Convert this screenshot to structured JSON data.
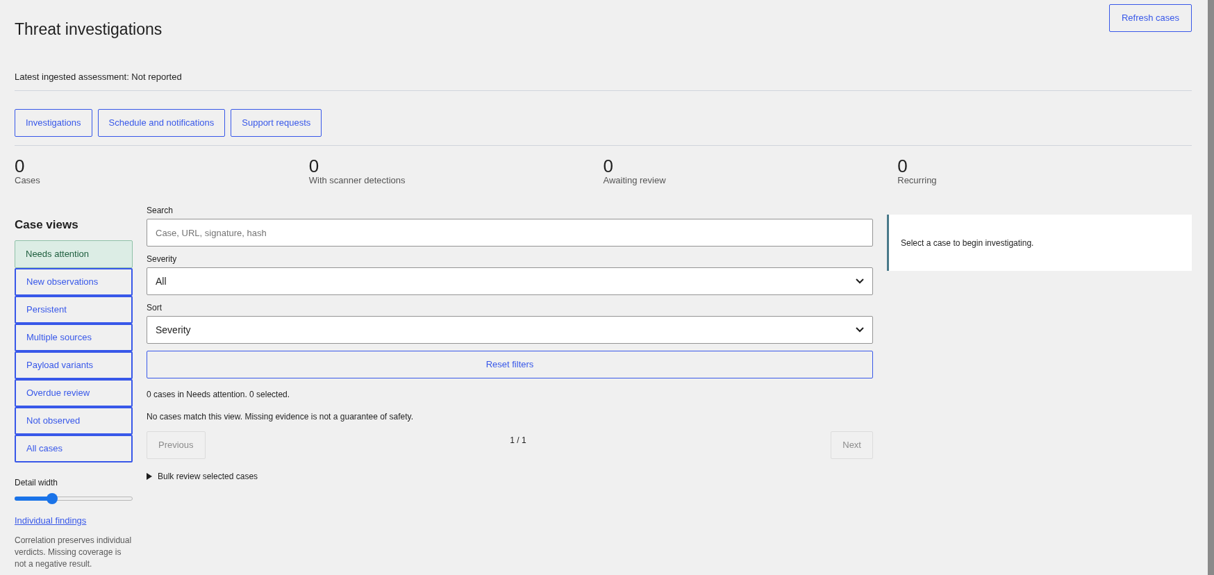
{
  "header": {
    "title": "Threat investigations",
    "refresh_button": "Refresh cases",
    "assessment": "Latest ingested assessment: Not reported"
  },
  "nav_buttons": [
    "Investigations",
    "Schedule and notifications",
    "Support requests"
  ],
  "stats": [
    {
      "value": "0",
      "label": "Cases"
    },
    {
      "value": "0",
      "label": "With scanner detections"
    },
    {
      "value": "0",
      "label": "Awaiting review"
    },
    {
      "value": "0",
      "label": "Recurring"
    }
  ],
  "sidebar": {
    "title": "Case views",
    "items": [
      {
        "label": "Needs attention",
        "selected": true
      },
      {
        "label": "New observations",
        "selected": false
      },
      {
        "label": "Persistent",
        "selected": false
      },
      {
        "label": "Multiple sources",
        "selected": false
      },
      {
        "label": "Payload variants",
        "selected": false
      },
      {
        "label": "Overdue review",
        "selected": false
      },
      {
        "label": "Not observed",
        "selected": false
      },
      {
        "label": "All cases",
        "selected": false
      }
    ],
    "slider": {
      "label": "Detail width",
      "level": 0.3
    },
    "link": "Individual findings",
    "note": "Correlation preserves individual verdicts. Missing coverage is not a negative result."
  },
  "filters": {
    "search": {
      "label": "Search",
      "placeholder": "Case, URL, signature, hash"
    },
    "severity": {
      "label": "Severity",
      "value": "All"
    },
    "sort": {
      "label": "Sort",
      "value": "Severity"
    },
    "reset_button": "Reset filters"
  },
  "results": {
    "summary": "0 cases in Needs attention. 0 selected.",
    "empty_message": "No cases match this view. Missing evidence is not a guarantee of safety.",
    "pagination": {
      "previous": "Previous",
      "page": "1 / 1",
      "next": "Next",
      "previous_disabled": true,
      "next_disabled": true
    },
    "bulk_review": {
      "label": "Bulk review selected cases",
      "expanded": false
    }
  },
  "detail_panel": {
    "message": "Select a case to begin investigating."
  }
}
